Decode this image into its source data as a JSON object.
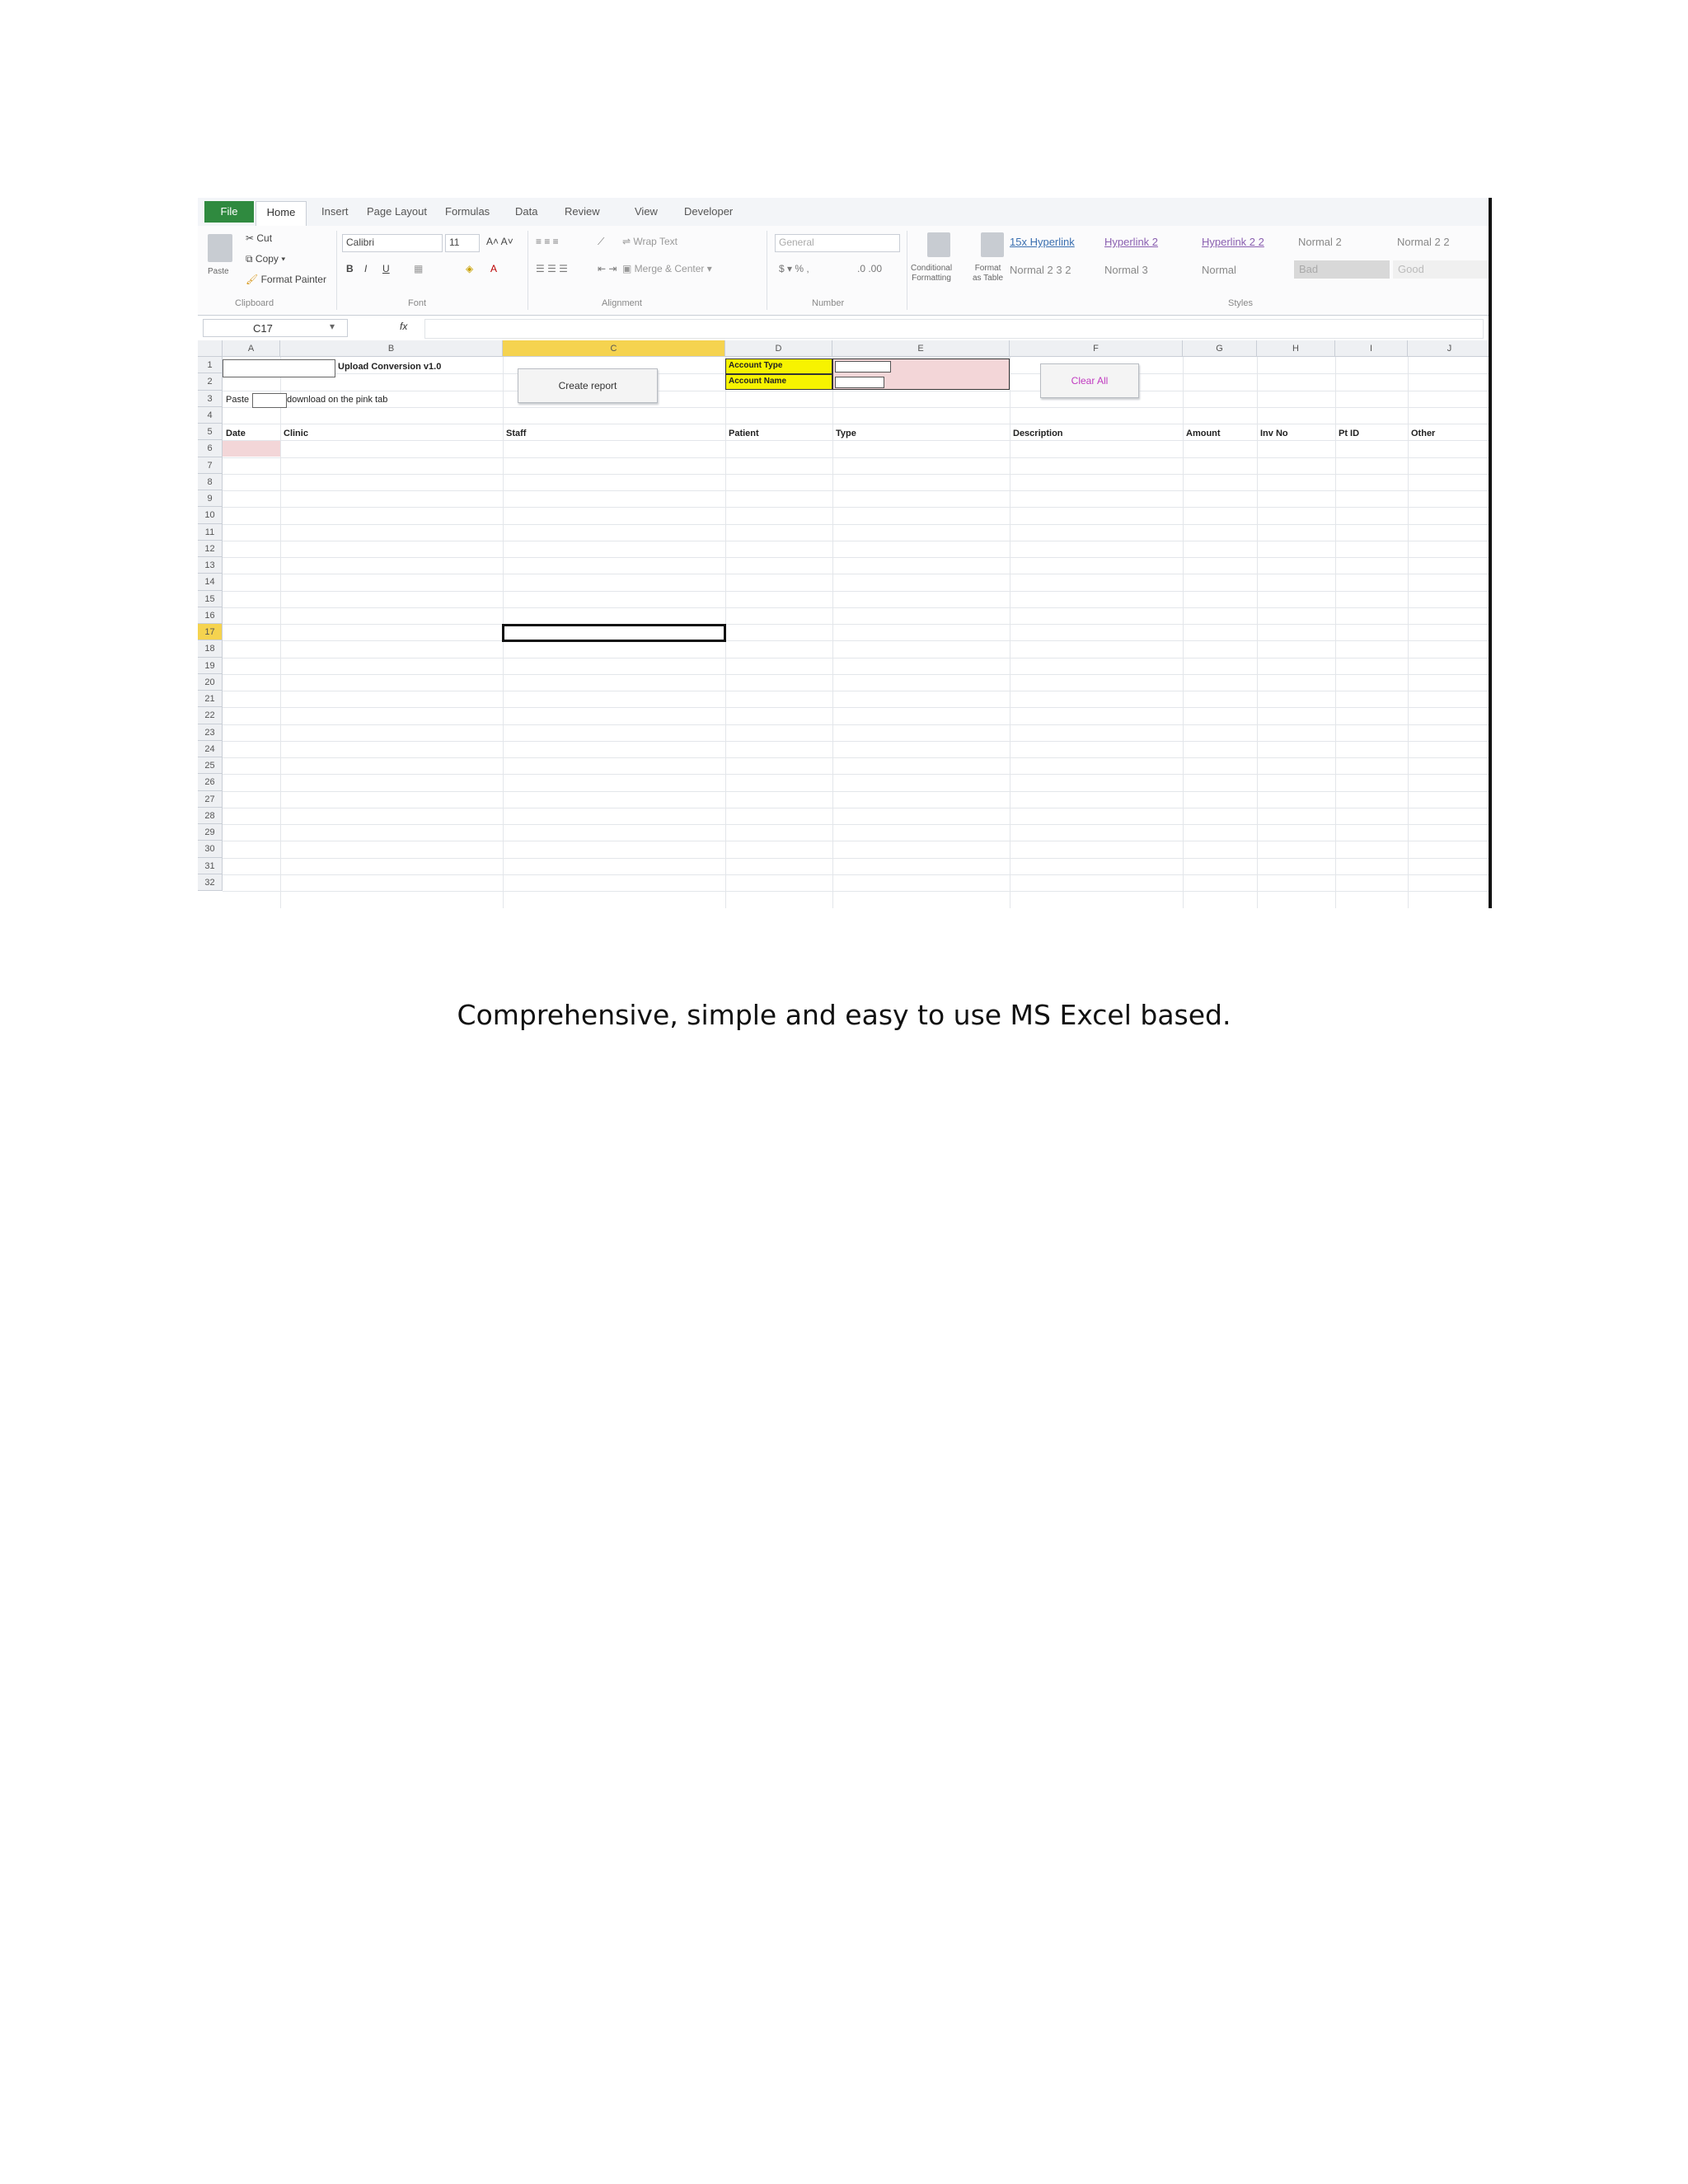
{
  "tabs": {
    "file": "File",
    "home": "Home",
    "insert": "Insert",
    "page_layout": "Page Layout",
    "formulas": "Formulas",
    "data": "Data",
    "review": "Review",
    "view": "View",
    "developer": "Developer"
  },
  "ribbon": {
    "cut": "Cut",
    "copy": "Copy ▾",
    "format_painter": "Format Painter",
    "paste": "Paste",
    "font_name": "Calibri",
    "font_size": "11",
    "wrap_text": "Wrap Text",
    "merge_center": "Merge & Center ▾",
    "number_format": "General",
    "conditional": "Conditional",
    "formatting": "Formatting",
    "format_as": "Format",
    "as_table": "as Table",
    "groups": {
      "clipboard": "Clipboard",
      "font": "Font",
      "alignment": "Alignment",
      "number": "Number",
      "styles": "Styles"
    },
    "styles": [
      "15x Hyperlink",
      "Hyperlink 2",
      "Hyperlink 2 2",
      "Normal 2",
      "Normal 2 2",
      "Normal 2 3 2",
      "Normal 3",
      "Normal",
      "Bad",
      "Good"
    ]
  },
  "formula_bar": {
    "name_box": "C17",
    "fx": "fx"
  },
  "columns": [
    "A",
    "B",
    "C",
    "D",
    "E",
    "F",
    "G",
    "H",
    "I",
    "J"
  ],
  "rows": [
    "1",
    "2",
    "3",
    "4",
    "5",
    "6",
    "7",
    "8",
    "9",
    "10",
    "11",
    "12",
    "13",
    "14",
    "15",
    "16",
    "17",
    "18",
    "19",
    "20",
    "21",
    "22",
    "23",
    "24",
    "25",
    "26",
    "27",
    "28",
    "29",
    "30",
    "31",
    "32"
  ],
  "sheet": {
    "title": "Upload Conversion v1.0",
    "paste_label": "Paste",
    "paste_hint": "download on the pink tab",
    "create_report_button": "Create report",
    "clear_all_button": "Clear All",
    "account_type": "Account Type",
    "account_name": "Account Name",
    "headers": [
      "Date",
      "Clinic",
      "Staff",
      "Patient",
      "Type",
      "Description",
      "Amount",
      "Inv No",
      "Pt ID",
      "Other"
    ]
  },
  "caption": "Comprehensive, simple and easy to use MS Excel based.",
  "colors": {
    "file_tab": "#2f8a3f",
    "selected_col": "#f5d34f",
    "account_label": "#f7f300",
    "pink_cell": "#f3d6d8"
  }
}
